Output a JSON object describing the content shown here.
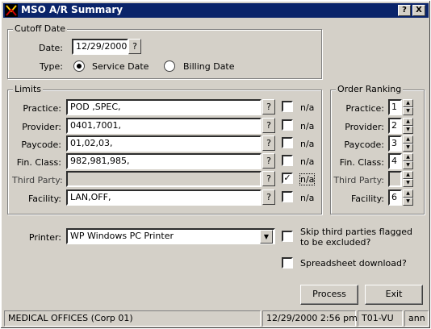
{
  "window": {
    "title": "MSO A/R Summary",
    "help_btn": "?",
    "close_btn": "X"
  },
  "cutoff": {
    "title": "Cutoff Date",
    "date_label": "Date:",
    "date_value": "12/29/2000",
    "type_label": "Type:",
    "service_label": "Service Date",
    "billing_label": "Billing Date",
    "selected": "service"
  },
  "limits": {
    "title": "Limits",
    "na_label": "n/a",
    "rows": [
      {
        "label": "Practice:",
        "value": "POD ,SPEC,",
        "na": false,
        "disabled": false
      },
      {
        "label": "Provider:",
        "value": "0401,7001,",
        "na": false,
        "disabled": false
      },
      {
        "label": "Paycode:",
        "value": "01,02,03,",
        "na": false,
        "disabled": false
      },
      {
        "label": "Fin. Class:",
        "value": "982,981,985,",
        "na": false,
        "disabled": false
      },
      {
        "label": "Third Party:",
        "value": "",
        "na": true,
        "disabled": true
      },
      {
        "label": "Facility:",
        "value": "LAN,OFF,",
        "na": false,
        "disabled": false
      }
    ]
  },
  "ranking": {
    "title": "Order Ranking",
    "rows": [
      {
        "label": "Practice:",
        "value": "1"
      },
      {
        "label": "Provider:",
        "value": "2"
      },
      {
        "label": "Paycode:",
        "value": "3"
      },
      {
        "label": "Fin. Class:",
        "value": "4"
      },
      {
        "label": "Third Party:",
        "value": ""
      },
      {
        "label": "Facility:",
        "value": "6"
      }
    ]
  },
  "printer": {
    "label": "Printer:",
    "value": "WP   Windows PC Printer"
  },
  "options": {
    "skip_label": "Skip third parties flagged to be excluded?",
    "skip_checked": false,
    "spreadsheet_label": "Spreadsheet download?",
    "spreadsheet_checked": false
  },
  "buttons": {
    "process": "Process",
    "exit": "Exit",
    "lookup": "?"
  },
  "statusbar": {
    "office": "MEDICAL OFFICES (Corp 01)",
    "datetime": "12/29/2000  2:56 pm",
    "terminal": "T01-VU",
    "user": "ann"
  },
  "colors": {
    "titlebar": "#0a246a",
    "face": "#d4d0c8"
  }
}
